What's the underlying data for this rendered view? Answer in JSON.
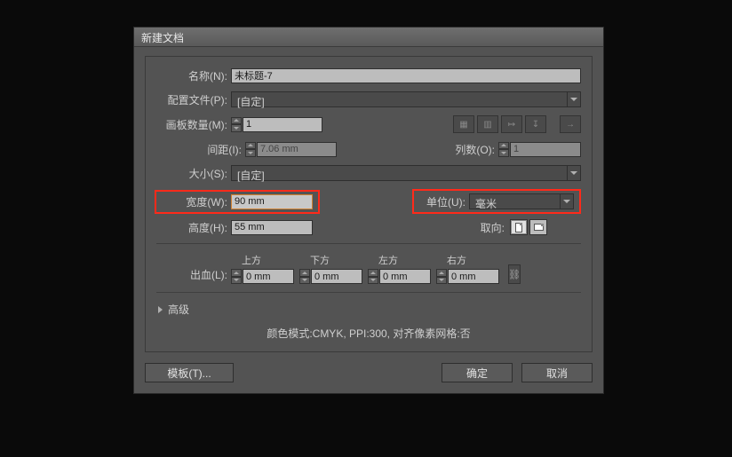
{
  "dialog": {
    "title": "新建文档"
  },
  "fields": {
    "name_label": "名称(N):",
    "name_value": "未标题-7",
    "profile_label": "配置文件(P):",
    "profile_value": "[自定]",
    "artboards_label": "画板数量(M):",
    "artboards_value": "1",
    "spacing_label": "间距(I):",
    "spacing_value": "7.06 mm",
    "cols_label": "列数(O):",
    "cols_value": "1",
    "size_label": "大小(S):",
    "size_value": "[自定]",
    "width_label": "宽度(W):",
    "width_value": "90 mm",
    "unit_label": "单位(U):",
    "unit_value": "毫米",
    "height_label": "高度(H):",
    "height_value": "55 mm",
    "orient_label": "取向:",
    "bleed_label": "出血(L):",
    "bleed_top_label": "上方",
    "bleed_bottom_label": "下方",
    "bleed_left_label": "左方",
    "bleed_right_label": "右方",
    "bleed_top": "0 mm",
    "bleed_bottom": "0 mm",
    "bleed_left": "0 mm",
    "bleed_right": "0 mm",
    "advanced_label": "高级",
    "summary": "颜色模式:CMYK, PPI:300, 对齐像素网格:否"
  },
  "buttons": {
    "templates": "模板(T)...",
    "ok": "确定",
    "cancel": "取消"
  }
}
